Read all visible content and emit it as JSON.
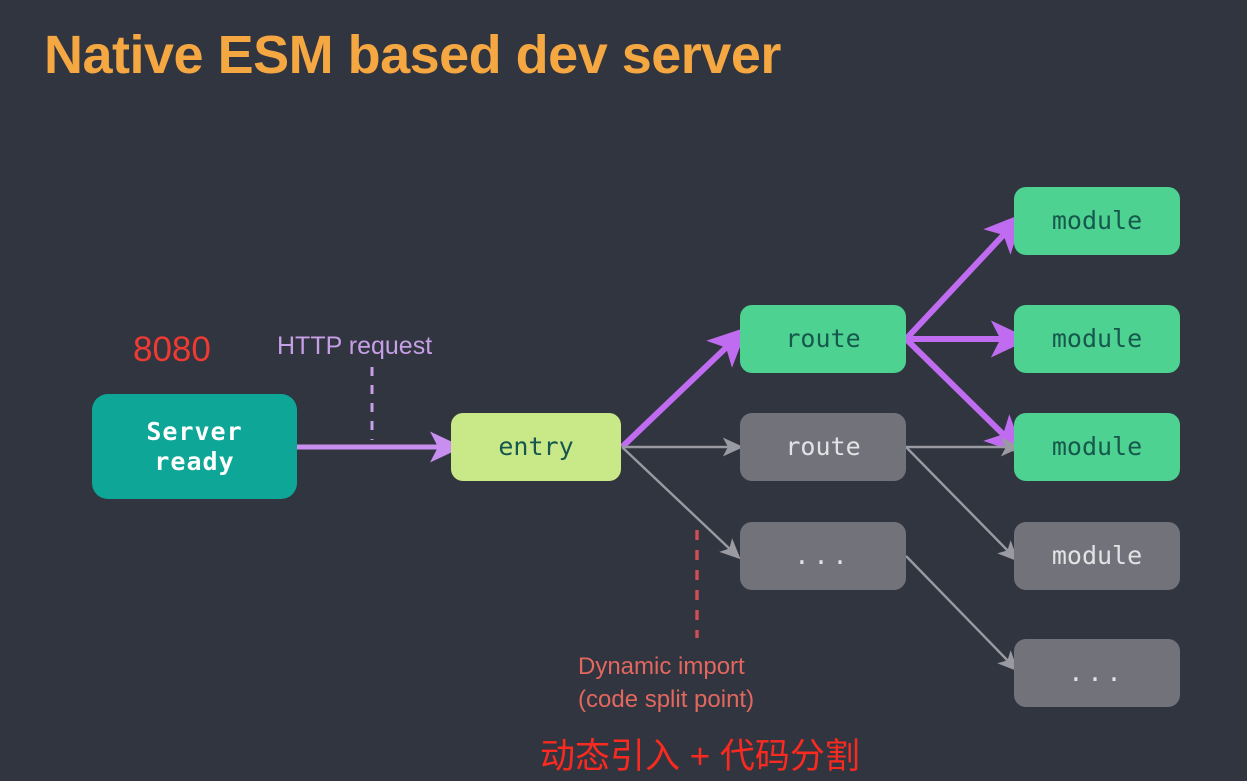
{
  "slide": {
    "title": "Native ESM based dev server",
    "background_color": "#31353f",
    "title_color": "#f5a742"
  },
  "labels": {
    "port": "8080",
    "http_request": "HTTP request",
    "dynamic_import_line1": "Dynamic import",
    "dynamic_import_line2": "(code split point)",
    "chinese_caption": "动态引入 + 代码分割"
  },
  "colors": {
    "teal": "#0ea697",
    "lime": "#c9e887",
    "green": "#4dd291",
    "grey": "#72737a",
    "purple": "#c06cf0",
    "light_purple": "#c79fe6",
    "arrow_grey": "#9a9aa2",
    "red": "#ef3a33",
    "salmon": "#e2675f",
    "bright_red": "#fa2a20",
    "orange": "#f5a742"
  },
  "nodes": {
    "server": "Server\nready",
    "entry": "entry",
    "route_active": "route",
    "route_inactive": "route",
    "route_more": "...",
    "module_1": "module",
    "module_2": "module",
    "module_3": "module",
    "module_4": "module",
    "module_more": "..."
  },
  "diagram_flow": {
    "type": "diagram",
    "edges": [
      {
        "from": "server",
        "to": "entry",
        "style": "solid",
        "color": "purple",
        "label": "HTTP request"
      },
      {
        "from": "entry",
        "to": "route_active",
        "style": "solid",
        "color": "purple"
      },
      {
        "from": "entry",
        "to": "route_inactive",
        "style": "solid",
        "color": "grey"
      },
      {
        "from": "entry",
        "to": "route_more",
        "style": "solid",
        "color": "grey"
      },
      {
        "from": "route_active",
        "to": "module_1",
        "style": "solid",
        "color": "purple"
      },
      {
        "from": "route_active",
        "to": "module_2",
        "style": "solid",
        "color": "purple"
      },
      {
        "from": "route_active",
        "to": "module_3",
        "style": "solid",
        "color": "purple"
      },
      {
        "from": "route_inactive",
        "to": "module_3",
        "style": "solid",
        "color": "grey"
      },
      {
        "from": "route_inactive",
        "to": "module_4",
        "style": "solid",
        "color": "grey"
      },
      {
        "from": "route_more",
        "to": "module_more",
        "style": "solid",
        "color": "grey"
      }
    ],
    "annotations": [
      {
        "text": "HTTP request",
        "target_edge": "server->entry",
        "marker": "dashed-purple"
      },
      {
        "text": "Dynamic import (code split point)",
        "target": "entry->route_more",
        "marker": "dashed-red"
      }
    ]
  }
}
